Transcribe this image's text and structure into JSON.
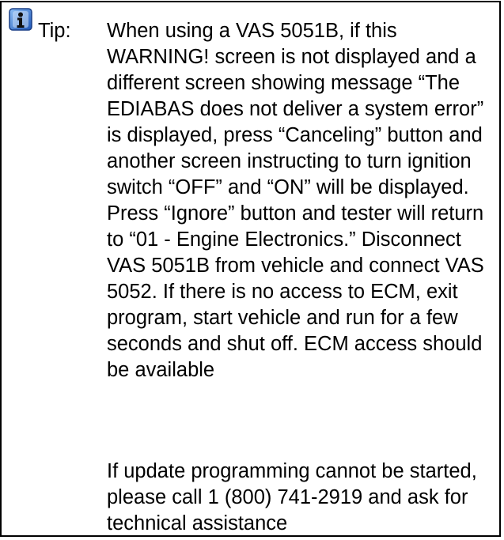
{
  "tip": {
    "icon": "info-icon",
    "icon_color": "#2f6fd0",
    "label": "Tip:",
    "paragraphs": [
      "When using a VAS 5051B, if this WARNING! screen is not displayed and a different screen showing message “The EDIABAS does not deliver a system error” is displayed, press “Canceling” button and another screen instructing to turn ignition switch “OFF” and “ON” will be displayed.  Press “Ignore” button and tester will return to “01 - Engine Electronics.”  Disconnect VAS 5051B from vehicle and connect VAS 5052. If there is no access to ECM, exit program, start vehicle and run for a few seconds and shut off.  ECM access should be available",
      "If update programming cannot be started, please call 1 (800) 741-2919 and ask for technical assistance"
    ]
  }
}
